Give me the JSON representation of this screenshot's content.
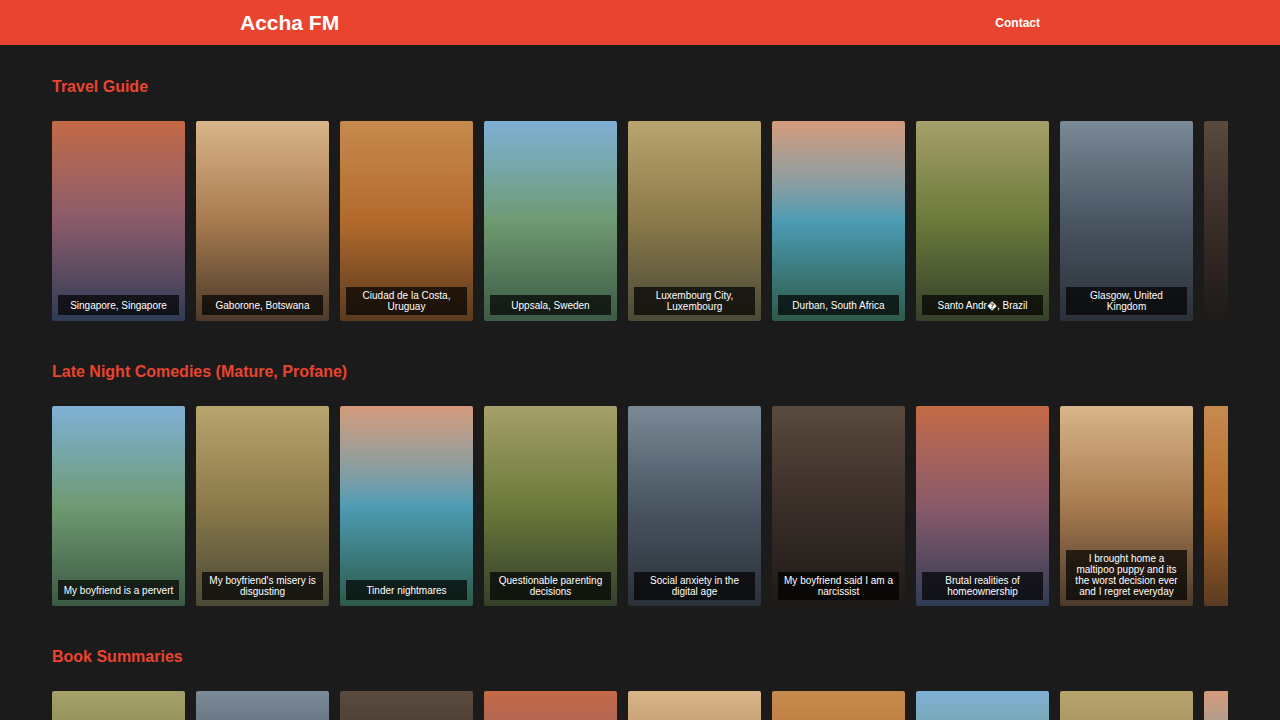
{
  "header": {
    "logo": "Accha FM",
    "nav": [
      "Contact"
    ]
  },
  "sections": [
    {
      "title": "Travel Guide",
      "cards": [
        "Singapore, Singapore",
        "Gaborone, Botswana",
        "Ciudad de la Costa, Uruguay",
        "Uppsala, Sweden",
        "Luxembourg City, Luxembourg",
        "Durban, South Africa",
        "Santo Andr�, Brazil",
        "Glasgow, United Kingdom"
      ]
    },
    {
      "title": "Late Night Comedies (Mature, Profane)",
      "cards": [
        "My boyfriend is a pervert",
        "My boyfriend's misery is disgusting",
        "Tinder nightmares",
        "Questionable parenting decisions",
        "Social anxiety in the digital age",
        "My boyfriend said I am a narcissist",
        "Brutal realities of homeownership",
        "I brought home a maltipoo puppy and its the worst decision ever and I regret everyday"
      ]
    },
    {
      "title": "Book Summaries",
      "cards": []
    }
  ]
}
